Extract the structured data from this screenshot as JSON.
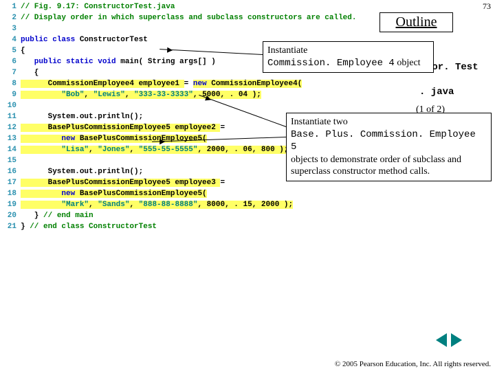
{
  "page_number": "73",
  "outline_title": "Outline",
  "side_labels": {
    "class_tail": "tor. Test",
    "file_ext": ". java",
    "page_info": "(1 of 2)"
  },
  "callouts": {
    "c1_line1": "Instantiate",
    "c1_line2": "Commission. Employee 4",
    "c1_line3": " object",
    "c2_line1": "Instantiate two",
    "c2_line2": "Base. Plus. Commission. Employee 5",
    "c2_line3": "objects to demonstrate order of subclass and superclass constructor method calls."
  },
  "code": {
    "l1": "// Fig. 9.17: ConstructorTest.java",
    "l2": "// Display order in which superclass and subclass constructors are called.",
    "l4a": "public class",
    "l4b": " ConstructorTest",
    "l5": "{",
    "l6a": "   public static void",
    "l6b": " main( String args[] )",
    "l7": "   {",
    "l8a": "      CommissionEmployee4 employee1 ",
    "l8b": "= ",
    "l8c": "new",
    "l8d": " CommissionEmployee4(",
    "l9a": "         \"Bob\"",
    "l9b": ", ",
    "l9c": "\"Lewis\"",
    "l9d": ", ",
    "l9e": "\"333-33-3333\"",
    "l9f": ", 5000, . 04 );",
    "l11": "      System.out.println();",
    "l12a": "      BasePlusCommissionEmployee5 employee2 ",
    "l12b": "=",
    "l13a": "         new",
    "l13b": " BasePlusCommissionEmployee5(",
    "l14a": "         \"Lisa\"",
    "l14b": ", ",
    "l14c": "\"Jones\"",
    "l14d": ", ",
    "l14e": "\"555-55-5555\"",
    "l14f": ", 2000, . 06, 800 );",
    "l16": "      System.out.println();",
    "l17a": "      BasePlusCommissionEmployee5 employee3 ",
    "l17b": "=",
    "l18a": "         new",
    "l18b": " BasePlusCommissionEmployee5(",
    "l19a": "         \"Mark\"",
    "l19b": ", ",
    "l19c": "\"Sands\"",
    "l19d": ", ",
    "l19e": "\"888-88-8888\"",
    "l19f": ", 8000, . 15, 2000 );",
    "l20a": "   } ",
    "l20b": "// end main",
    "l21a": "} ",
    "l21b": "// end class ConstructorTest"
  },
  "copyright": "© 2005 Pearson Education, Inc. All rights reserved."
}
